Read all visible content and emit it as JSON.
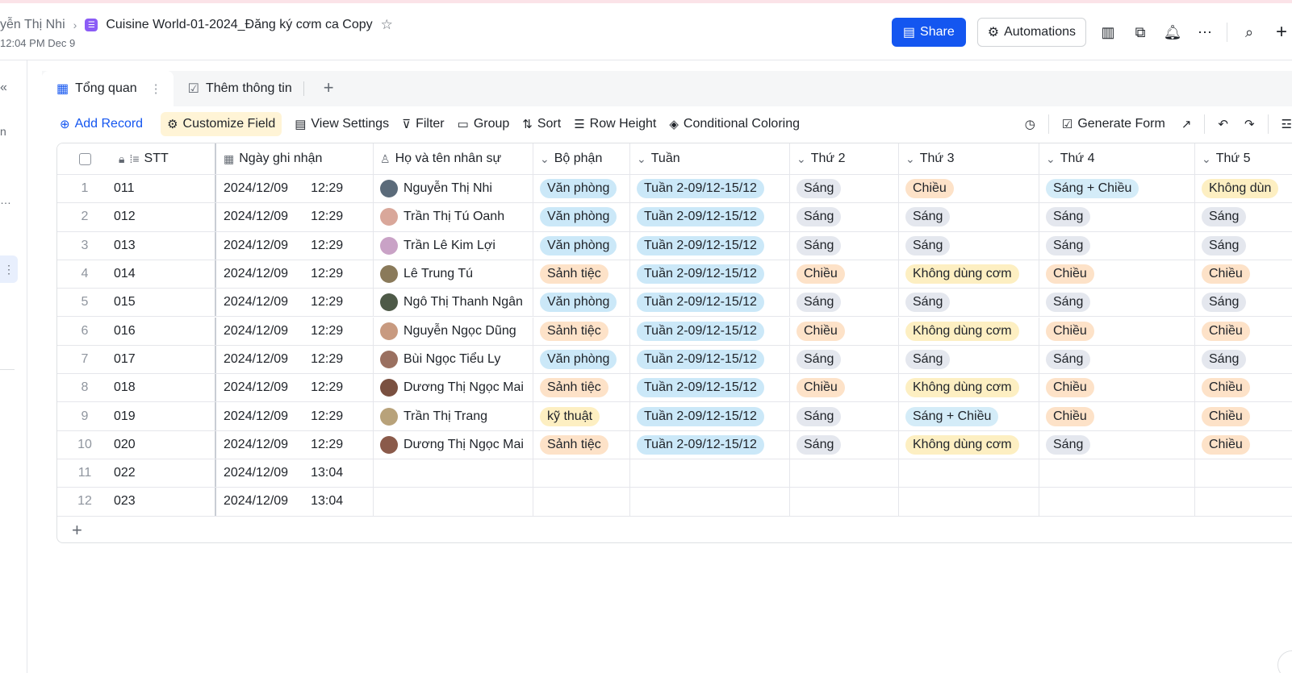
{
  "header": {
    "owner_partial": "yễn Thị Nhi",
    "doc_title": "Cuisine World-01-2024_Đăng ký cơm ca  Copy",
    "timestamp_partial": "12:04 PM Dec 9",
    "share_label": "Share",
    "automations_label": "Automations"
  },
  "tabs": [
    {
      "label": "Tổng quan"
    },
    {
      "label": "Thêm thông tin"
    }
  ],
  "toolbar": {
    "add_record": "Add Record",
    "customize_field": "Customize Field",
    "view_settings": "View Settings",
    "filter": "Filter",
    "group": "Group",
    "sort": "Sort",
    "row_height": "Row Height",
    "conditional_coloring": "Conditional Coloring",
    "generate_form": "Generate Form"
  },
  "columns": {
    "stt": "STT",
    "date": "Ngày ghi nhận",
    "name": "Họ và tên nhân sự",
    "dept": "Bộ phận",
    "week": "Tuần",
    "mon": "Thứ 2",
    "tue": "Thứ 3",
    "wed": "Thứ 4",
    "thu": "Thứ 5"
  },
  "rows": [
    {
      "n": "1",
      "stt": "011",
      "date": "2024/12/09",
      "time": "12:29",
      "name": "Nguyễn Thị  Nhi",
      "dept": "Văn phòng",
      "week": "Tuần 2-09/12-15/12",
      "mon": "Sáng",
      "tue": "Chiều",
      "wed": "Sáng + Chiều",
      "thu": "Không dùn"
    },
    {
      "n": "2",
      "stt": "012",
      "date": "2024/12/09",
      "time": "12:29",
      "name": "Trần Thị Tú Oanh",
      "dept": "Văn phòng",
      "week": "Tuần 2-09/12-15/12",
      "mon": "Sáng",
      "tue": "Sáng",
      "wed": "Sáng",
      "thu": "Sáng"
    },
    {
      "n": "3",
      "stt": "013",
      "date": "2024/12/09",
      "time": "12:29",
      "name": "Trần Lê Kim Lợi",
      "dept": "Văn phòng",
      "week": "Tuần 2-09/12-15/12",
      "mon": "Sáng",
      "tue": "Sáng",
      "wed": "Sáng",
      "thu": "Sáng"
    },
    {
      "n": "4",
      "stt": "014",
      "date": "2024/12/09",
      "time": "12:29",
      "name": "Lê Trung Tú",
      "dept": "Sảnh tiệc",
      "week": "Tuần 2-09/12-15/12",
      "mon": "Chiều",
      "tue": "Không dùng cơm",
      "wed": "Chiều",
      "thu": "Chiều"
    },
    {
      "n": "5",
      "stt": "015",
      "date": "2024/12/09",
      "time": "12:29",
      "name": "Ngô Thị Thanh Ngân",
      "dept": "Văn phòng",
      "week": "Tuần 2-09/12-15/12",
      "mon": "Sáng",
      "tue": "Sáng",
      "wed": "Sáng",
      "thu": "Sáng"
    },
    {
      "n": "6",
      "stt": "016",
      "date": "2024/12/09",
      "time": "12:29",
      "name": "Nguyễn Ngọc Dũng",
      "dept": "Sảnh tiệc",
      "week": "Tuần 2-09/12-15/12",
      "mon": "Chiều",
      "tue": "Không dùng cơm",
      "wed": "Chiều",
      "thu": "Chiều"
    },
    {
      "n": "7",
      "stt": "017",
      "date": "2024/12/09",
      "time": "12:29",
      "name": "Bùi Ngọc Tiểu Ly",
      "dept": "Văn phòng",
      "week": "Tuần 2-09/12-15/12",
      "mon": "Sáng",
      "tue": "Sáng",
      "wed": "Sáng",
      "thu": "Sáng"
    },
    {
      "n": "8",
      "stt": "018",
      "date": "2024/12/09",
      "time": "12:29",
      "name": "Dương Thị Ngọc Mai",
      "dept": "Sảnh tiệc",
      "week": "Tuần 2-09/12-15/12",
      "mon": "Chiều",
      "tue": "Không dùng cơm",
      "wed": "Chiều",
      "thu": "Chiều"
    },
    {
      "n": "9",
      "stt": "019",
      "date": "2024/12/09",
      "time": "12:29",
      "name": "Trần Thị Trang",
      "dept": "kỹ thuật",
      "week": "Tuần 2-09/12-15/12",
      "mon": "Sáng",
      "tue": "Sáng + Chiều",
      "wed": "Chiều",
      "thu": "Chiều"
    },
    {
      "n": "10",
      "stt": "020",
      "date": "2024/12/09",
      "time": "12:29",
      "name": "Dương Thị Ngọc Mai",
      "dept": "Sảnh tiệc",
      "week": "Tuần 2-09/12-15/12",
      "mon": "Sáng",
      "tue": "Không dùng cơm",
      "wed": "Sáng",
      "thu": "Chiều"
    },
    {
      "n": "11",
      "stt": "022",
      "date": "2024/12/09",
      "time": "13:04",
      "name": "",
      "dept": "",
      "week": "",
      "mon": "",
      "tue": "",
      "wed": "",
      "thu": ""
    },
    {
      "n": "12",
      "stt": "023",
      "date": "2024/12/09",
      "time": "13:04",
      "name": "",
      "dept": "",
      "week": "",
      "mon": "",
      "tue": "",
      "wed": "",
      "thu": ""
    }
  ],
  "colors": {
    "accent": "#1456f0",
    "tag_office": "#cbe8f8",
    "tag_hall": "#fde2c8",
    "tag_tech": "#fdefc2",
    "tag_morning": "#e4e7ee",
    "tag_afternoon": "#fde2c8",
    "tag_none": "#fde2c8",
    "tag_both": "#d4ecf8",
    "tag_not_eating": "#fdefc2"
  }
}
